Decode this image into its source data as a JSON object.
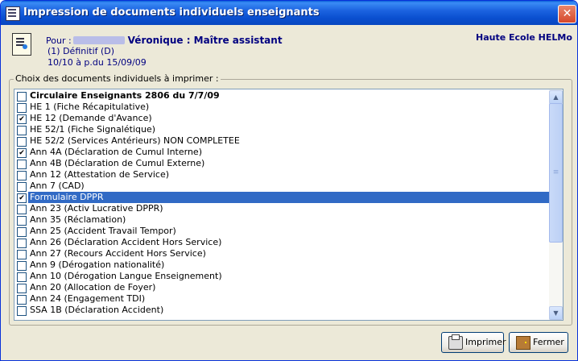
{
  "window": {
    "title": "Impression de documents individuels enseignants",
    "close_label": "✕"
  },
  "header": {
    "pour_label": "Pour :",
    "person": "Véronique : Maître assistant",
    "line2": "(1) Définitif (D)",
    "line3": "10/10 à p.du 15/09/09",
    "school": "Haute Ecole HELMo"
  },
  "group_label": "Choix des documents individuels à imprimer :",
  "documents": [
    {
      "label": "Circulaire Enseignants 2806 du 7/7/09",
      "check": "",
      "bold": true
    },
    {
      "label": "HE 1 (Fiche Récapitulative)",
      "check": ""
    },
    {
      "label": "HE 12 (Demande d'Avance)",
      "check": "✔"
    },
    {
      "label": "HE 52/1 (Fiche Signalétique)",
      "check": ""
    },
    {
      "label": "HE 52/2 (Services Antérieurs) NON COMPLETEE",
      "check": ""
    },
    {
      "label": "Ann 4A (Déclaration de Cumul Interne)",
      "check": "✔"
    },
    {
      "label": "Ann 4B (Déclaration de Cumul Externe)",
      "check": ""
    },
    {
      "label": "Ann 12 (Attestation de Service)",
      "check": ""
    },
    {
      "label": "Ann 7 (CAD)",
      "check": ""
    },
    {
      "label": "Formulaire DPPR",
      "check": "✔",
      "selected": true
    },
    {
      "label": "Ann 23 (Activ Lucrative DPPR)",
      "check": ""
    },
    {
      "label": "Ann 35 (Réclamation)",
      "check": ""
    },
    {
      "label": "Ann 25 (Accident Travail Tempor)",
      "check": ""
    },
    {
      "label": "Ann 26 (Déclaration Accident Hors Service)",
      "check": ""
    },
    {
      "label": "Ann 27 (Recours Accident Hors Service)",
      "check": ""
    },
    {
      "label": "Ann 9 (Dérogation nationalité)",
      "check": ""
    },
    {
      "label": "Ann 10 (Dérogation Langue Enseignement)",
      "check": ""
    },
    {
      "label": "Ann 20 (Allocation de Foyer)",
      "check": ""
    },
    {
      "label": "Ann 24 (Engagement TDI)",
      "check": ""
    },
    {
      "label": "SSA 1B (Déclaration Accident)",
      "check": ""
    }
  ],
  "scrollbar": {
    "up": "▲",
    "down": "▼",
    "grip": "≡"
  },
  "buttons": {
    "print": "Imprimer",
    "close": "Fermer"
  },
  "icons": {
    "title": "document-list-icon",
    "header": "teacher-document-icon",
    "print": "printer-icon",
    "close": "door-icon"
  },
  "colors": {
    "title_bar": "#0a50d0",
    "header_text": "#000080",
    "selection": "#316ac5",
    "dialog_bg": "#ece9d8"
  }
}
